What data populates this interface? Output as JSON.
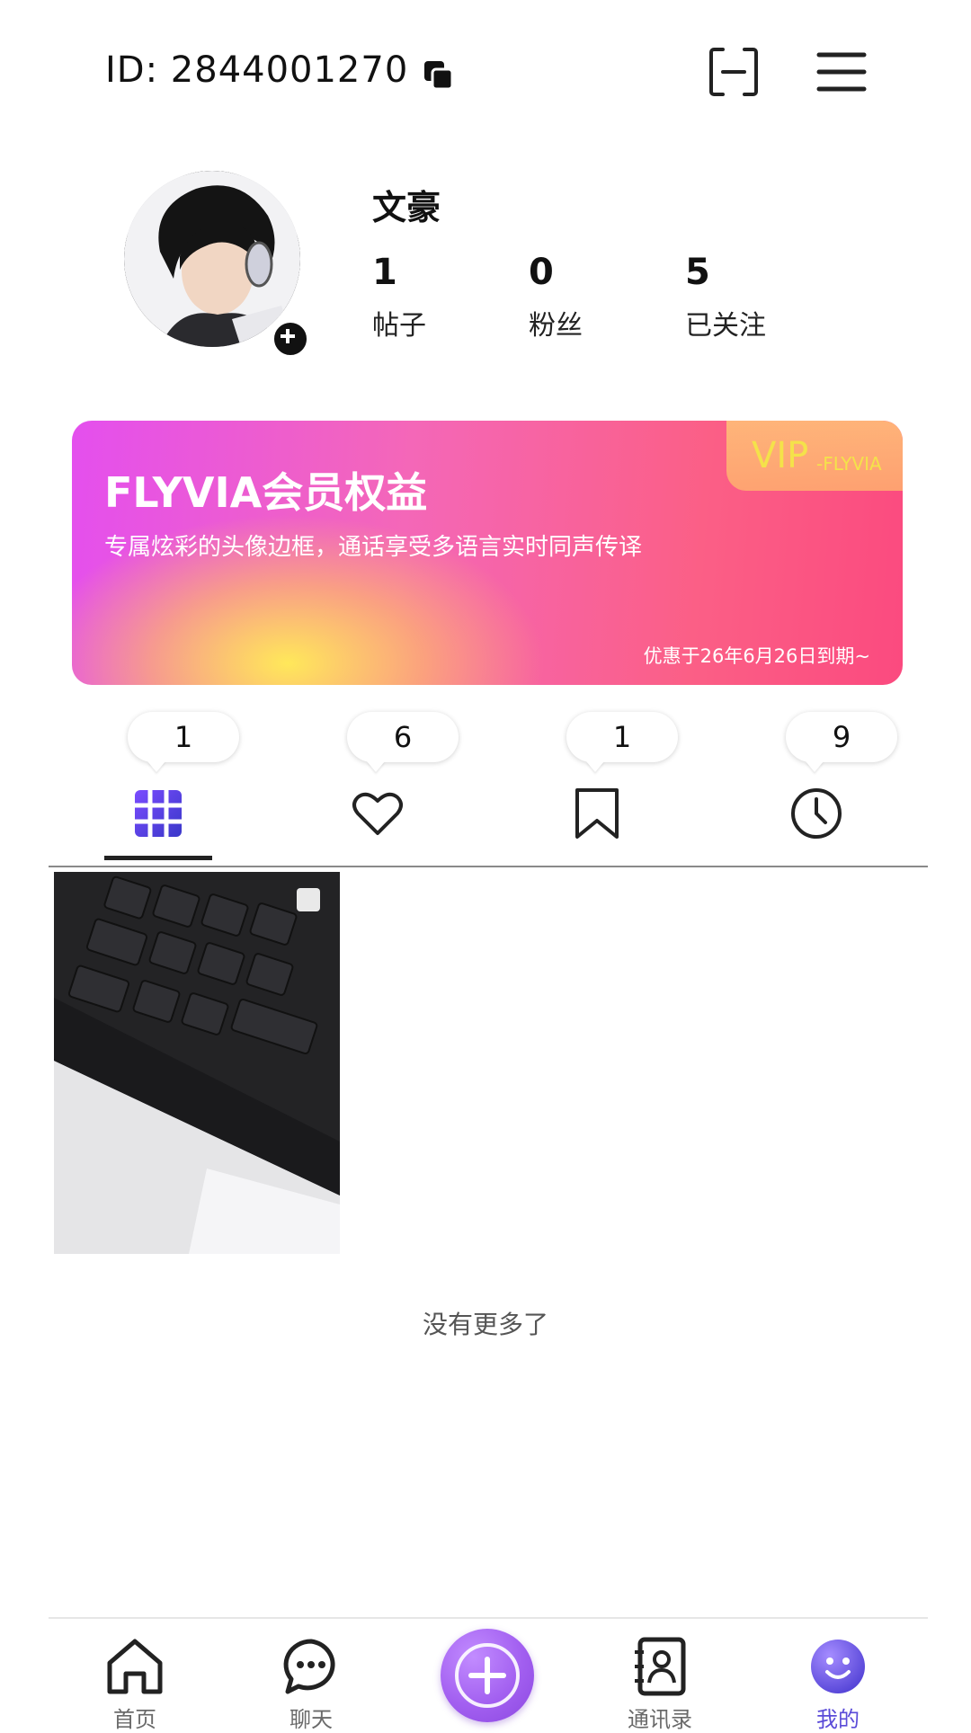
{
  "header": {
    "user_id": "ID: 2844001270",
    "icons": {
      "copy": "copy-icon",
      "scan": "scan-icon",
      "menu": "menu-icon"
    }
  },
  "profile": {
    "username": "文豪",
    "stats": [
      {
        "value": "1",
        "label": "帖子"
      },
      {
        "value": "0",
        "label": "粉丝"
      },
      {
        "value": "5",
        "label": "已关注"
      }
    ]
  },
  "vip_card": {
    "badge_main": "VIP",
    "badge_sub": "-FLYVIA",
    "title": "FLYVIA会员权益",
    "description": "专属炫彩的头像边框，通话享受多语言实时同声传译",
    "expiry": "优惠于26年6月26日到期~",
    "colors": {
      "start": "#e44fee",
      "end": "#fb4a7f",
      "glow": "#ffe85a",
      "badge_text": "#f4e24a"
    }
  },
  "tabs": [
    {
      "count": "1",
      "icon": "grid-icon",
      "active": true
    },
    {
      "count": "6",
      "icon": "heart-icon",
      "active": false
    },
    {
      "count": "1",
      "icon": "bookmark-icon",
      "active": false
    },
    {
      "count": "9",
      "icon": "clock-icon",
      "active": false
    }
  ],
  "posts": {
    "end_text": "没有更多了"
  },
  "bottom_nav": [
    {
      "label": "首页",
      "icon": "home-icon"
    },
    {
      "label": "聊天",
      "icon": "chat-icon"
    },
    {
      "label": "",
      "icon": "plus-icon"
    },
    {
      "label": "通讯录",
      "icon": "contacts-icon"
    },
    {
      "label": "我的",
      "icon": "profile-face-icon",
      "active": true
    }
  ],
  "colors": {
    "accent": "#8b47e0",
    "active_nav_label": "#5a4bd8"
  }
}
